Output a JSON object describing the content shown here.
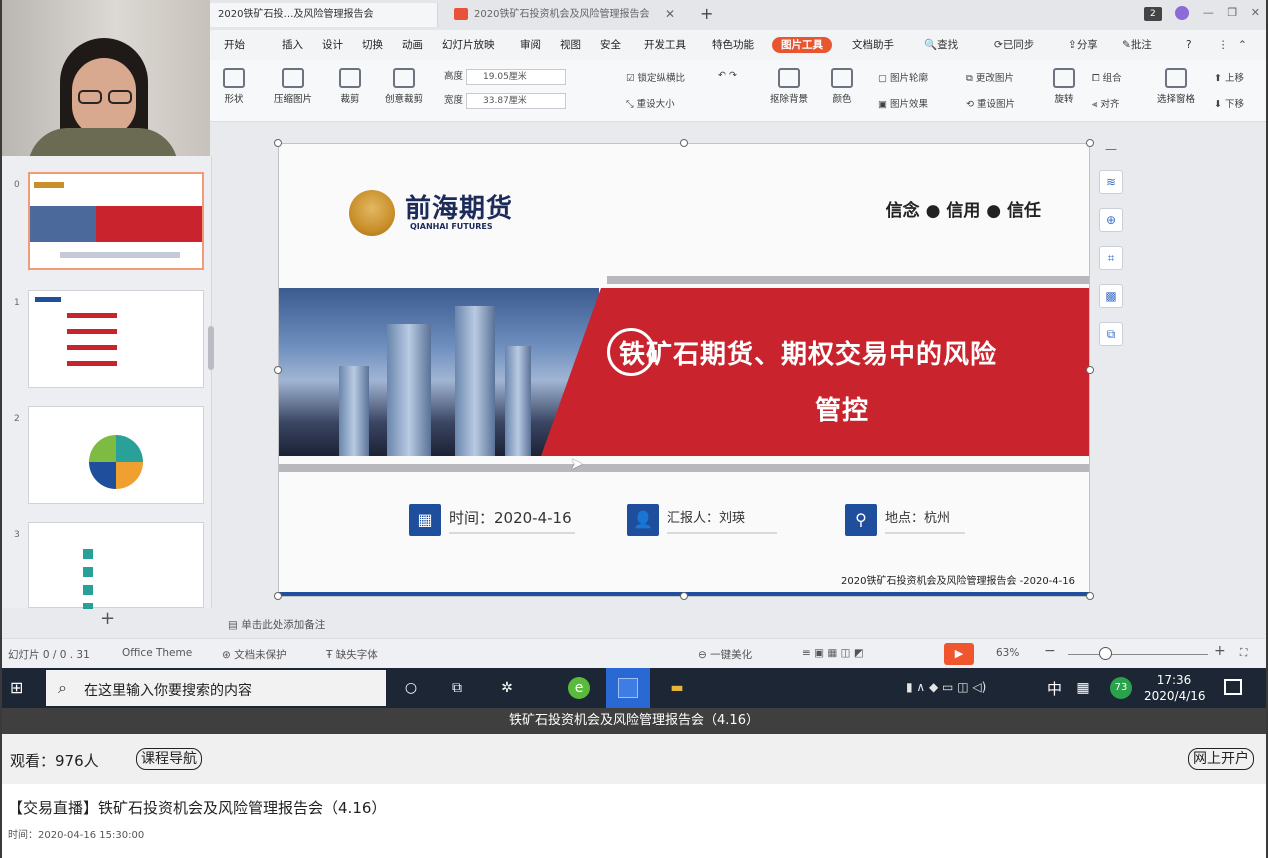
{
  "wps": {
    "tabs": [
      {
        "label": "2020铁矿石投…及风险管理报告会"
      },
      {
        "label": "2020铁矿石投资机会及风险管理报告会"
      }
    ],
    "menu": [
      "开始",
      "插入",
      "设计",
      "切换",
      "动画",
      "幻灯片放映",
      "审阅",
      "视图",
      "安全",
      "开发工具",
      "特色功能",
      "图片工具",
      "文档助手"
    ],
    "menu_right": {
      "search": "查找",
      "sync": "已同步",
      "share": "分享",
      "review": "批注"
    },
    "ribbon": {
      "shape": "形状",
      "compress": "压缩图片",
      "crop": "裁剪",
      "creative_crop": "创意裁剪",
      "height_label": "高度",
      "height_value": "19.05厘米",
      "width_label": "宽度",
      "width_value": "33.87厘米",
      "lock_ratio": "锁定纵横比",
      "reset_size": "重设大小",
      "remove_bg": "抠除背景",
      "color": "颜色",
      "pic_outline": "图片轮廓",
      "change_pic": "更改图片",
      "pic_effect": "图片效果",
      "reset_pic": "重设图片",
      "rotate": "旋转",
      "group": "组合",
      "align": "对齐",
      "select_pane": "选择窗格",
      "up": "上移",
      "down": "下移"
    },
    "thumb_numbers": [
      "0",
      "1",
      "2",
      "3"
    ],
    "notes_hint": "单击此处添加备注",
    "status": {
      "slide_count": "幻灯片 0 / 0 . 31",
      "theme": "Office Theme",
      "doc_protect": "文档未保护",
      "missing_font": "缺失字体",
      "beautify": "一键美化",
      "zoom": "63%"
    }
  },
  "slide": {
    "logo_cn": "前海期货",
    "logo_en": "QIANHAI FUTURES",
    "slogan": "信念 ● 信用 ● 信任",
    "title_line1": "铁矿石期货、期权交易中的风险",
    "title_line2": "管控",
    "time": "时间：2020-4-16",
    "reporter": "汇报人：刘瑛",
    "place": "地点：杭州",
    "footer": "2020铁矿石投资机会及风险管理报告会 -2020-4-16"
  },
  "taskbar": {
    "search_placeholder": "在这里输入你要搜索的内容",
    "ime": "中",
    "time": "17:36",
    "date": "2020/4/16"
  },
  "live": {
    "title_bar": "铁矿石投资机会及风险管理报告会（4.16）",
    "viewers": "观看：976人",
    "nav_btn": "课程导航",
    "open_account": "网上开户",
    "event_title": "【交易直播】铁矿石投资机会及风险管理报告会（4.16）",
    "event_time": "时间：2020-04-16 15:30:00"
  },
  "colors": {
    "accent": "#e8562f",
    "brand_red": "#c9232e",
    "brand_blue": "#1f4e9c"
  }
}
